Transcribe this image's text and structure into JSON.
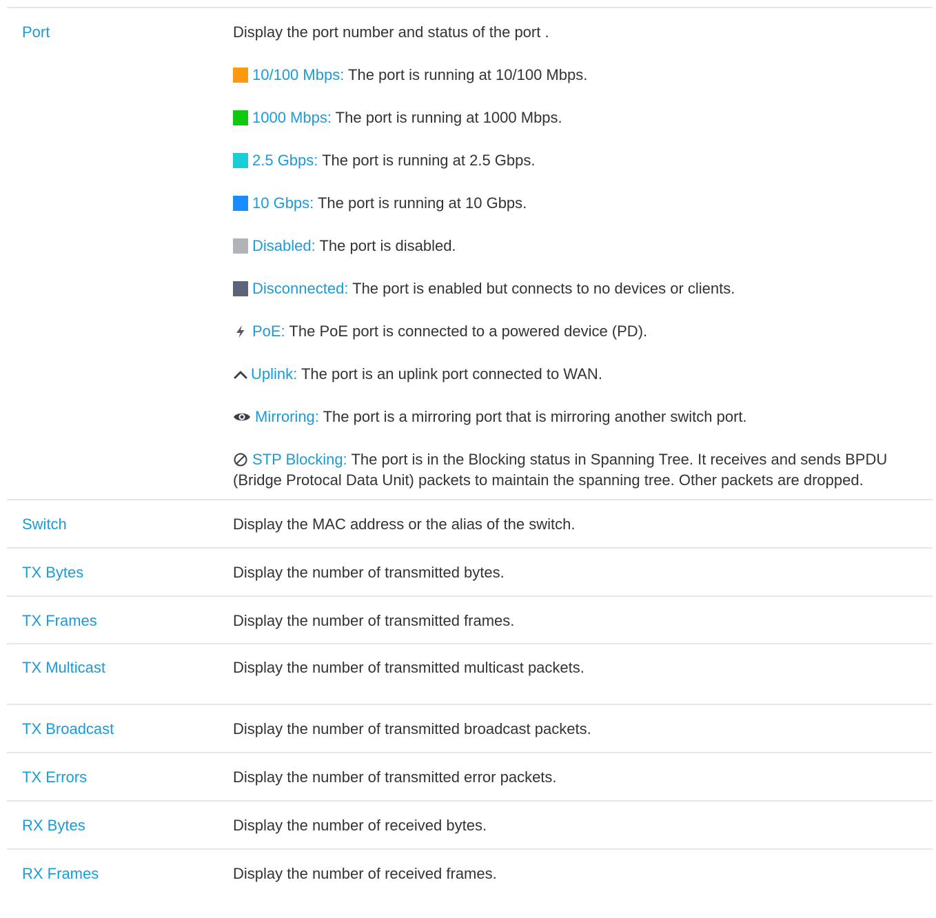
{
  "rows": {
    "port": {
      "term": "Port",
      "intro": "Display the port number and status of the port .",
      "legend": [
        {
          "label": "10/100 Mbps:",
          "text": " The port is running at 10/100 Mbps.",
          "color": "#ff9a10"
        },
        {
          "label": "1000 Mbps:",
          "text": " The port is running at 1000 Mbps.",
          "color": "#10c810"
        },
        {
          "label": "2.5 Gbps:",
          "text": " The port is running at 2.5 Gbps.",
          "color": "#18cfd8"
        },
        {
          "label": "10 Gbps:",
          "text": " The port is running at 10 Gbps.",
          "color": "#1a8cff"
        },
        {
          "label": "Disabled:",
          "text": " The port is disabled.",
          "color": "#b0b3b8"
        },
        {
          "label": "Disconnected:",
          "text": " The port is enabled but connects to no devices or clients.",
          "color": "#5d6478"
        },
        {
          "label": "PoE:",
          "text": " The PoE port is connected to a powered device (PD).",
          "icon": "lightning-icon"
        },
        {
          "label": "Uplink:",
          "text": " The port is an uplink port connected to WAN.",
          "icon": "chevron-up-icon"
        },
        {
          "label": "Mirroring:",
          "text": " The port is a mirroring port that is mirroring another switch port.",
          "icon": "eye-icon"
        },
        {
          "label": "STP Blocking:",
          "text": " The port is in the Blocking status in Spanning Tree. It receives and sends BPDU (Bridge Protocal Data Unit) packets to maintain the spanning tree. Other packets are dropped.",
          "icon": "blocked-icon"
        }
      ]
    },
    "switch": {
      "term": "Switch",
      "desc": "Display the MAC address or the alias of the switch."
    },
    "tx_bytes": {
      "term": "TX Bytes",
      "desc": "Display the number of transmitted bytes."
    },
    "tx_frames": {
      "term": "TX Frames",
      "desc": "Display the number of transmitted frames."
    },
    "tx_multicast": {
      "term": "TX Multicast",
      "desc": "Display the number of transmitted multicast packets."
    },
    "tx_broadcast": {
      "term": "TX Broadcast",
      "desc": "Display the number of transmitted broadcast packets."
    },
    "tx_errors": {
      "term": "TX Errors",
      "desc": "Display the number of transmitted error packets."
    },
    "rx_bytes": {
      "term": "RX Bytes",
      "desc": "Display the number of received bytes."
    },
    "rx_frames": {
      "term": "RX Frames",
      "desc": "Display the number of received frames."
    }
  },
  "colors": {
    "label": "#1a9bd7",
    "text": "#333333",
    "divider": "#e6e6e6"
  }
}
